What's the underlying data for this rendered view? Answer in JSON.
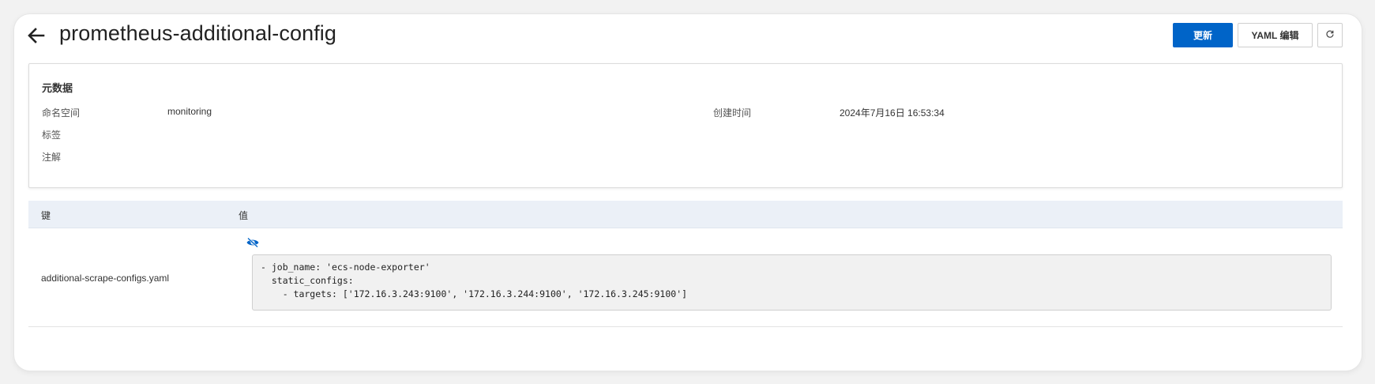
{
  "header": {
    "title": "prometheus-additional-config",
    "back_icon": "arrow-left-icon",
    "update_label": "更新",
    "yaml_edit_label": "YAML 编辑",
    "refresh_icon": "refresh-icon"
  },
  "metadata": {
    "title": "元数据",
    "namespace_label": "命名空间",
    "namespace_value": "monitoring",
    "created_label": "创建时间",
    "created_value": "2024年7月16日 16:53:34",
    "labels_label": "标签",
    "annotations_label": "注解"
  },
  "table": {
    "columns": [
      "键",
      "值"
    ],
    "rows": [
      {
        "key": "additional-scrape-configs.yaml",
        "value": "- job_name: 'ecs-node-exporter'\n  static_configs:\n    - targets: ['172.16.3.243:9100', '172.16.3.244:9100', '172.16.3.245:9100']"
      }
    ],
    "toggle_icon": "eye-slash-icon"
  },
  "colors": {
    "primary": "#0064c8",
    "table_header_bg": "#ebf0f7"
  }
}
